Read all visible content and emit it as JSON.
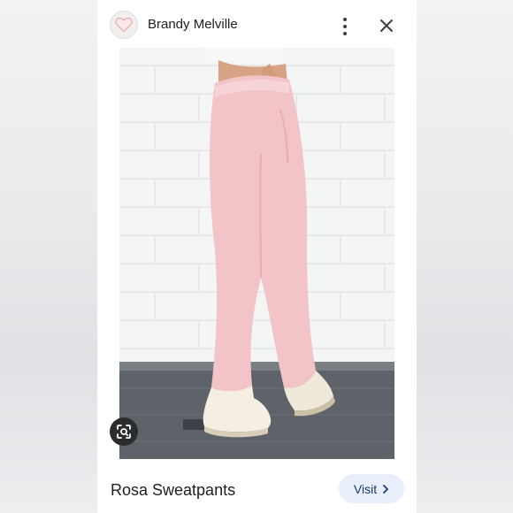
{
  "header": {
    "site_name": "Brandy Melville",
    "logo_icon": "heart-icon",
    "more_icon": "more-vert-icon",
    "close_icon": "close-icon"
  },
  "image": {
    "subject_icon": "product-photo",
    "lens_icon": "lens-search-icon"
  },
  "footer": {
    "title": "Rosa Sweatpants",
    "visit_label": "Visit",
    "visit_icon": "chevron-right-icon"
  },
  "colors": {
    "accent_bg": "#e8effb",
    "accent_text": "#1a3b73",
    "pants_pink": "#f2c4c8"
  }
}
